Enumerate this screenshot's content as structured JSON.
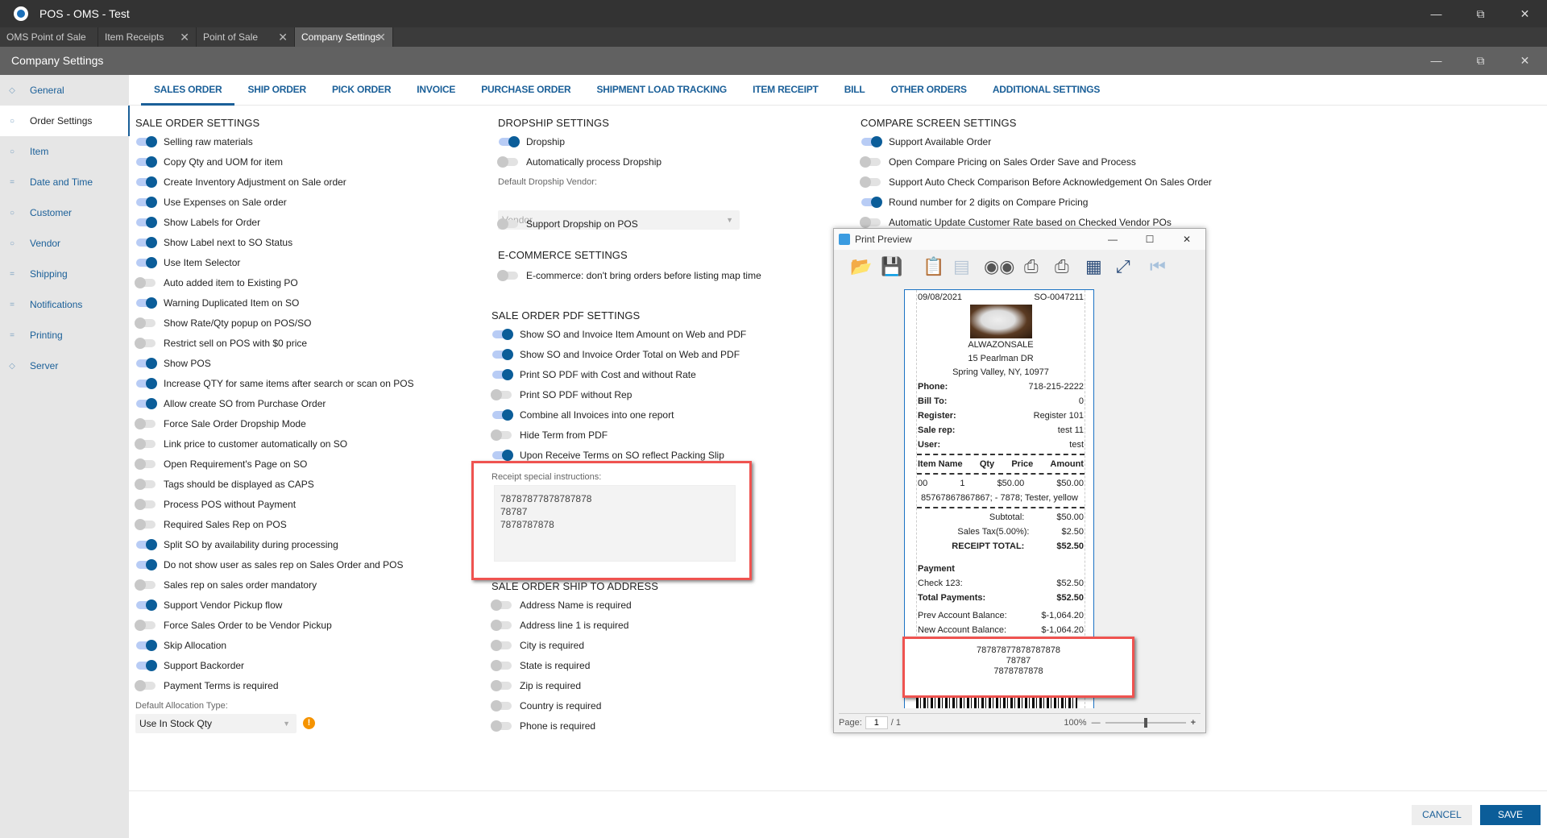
{
  "app_title": "POS - OMS - Test",
  "doc_tabs": [
    {
      "label": "OMS Point of Sale",
      "closable": false
    },
    {
      "label": "Item Receipts",
      "closable": true
    },
    {
      "label": "Point of Sale",
      "closable": true
    },
    {
      "label": "Company Settings",
      "closable": true,
      "active": true
    }
  ],
  "header_title": "Company Settings",
  "sidebar": [
    {
      "label": "General",
      "icon": "◇"
    },
    {
      "label": "Order Settings",
      "icon": "○",
      "active": true
    },
    {
      "label": "Item",
      "icon": "○"
    },
    {
      "label": "Date and Time",
      "icon": "="
    },
    {
      "label": "Customer",
      "icon": "○"
    },
    {
      "label": "Vendor",
      "icon": "○"
    },
    {
      "label": "Shipping",
      "icon": "="
    },
    {
      "label": "Notifications",
      "icon": "="
    },
    {
      "label": "Printing",
      "icon": "="
    },
    {
      "label": "Server",
      "icon": "◇"
    }
  ],
  "tabs": [
    "SALES ORDER",
    "SHIP ORDER",
    "PICK ORDER",
    "INVOICE",
    "PURCHASE ORDER",
    "SHIPMENT LOAD TRACKING",
    "ITEM RECEIPT",
    "BILL",
    "OTHER ORDERS",
    "ADDITIONAL SETTINGS"
  ],
  "sale_order_settings": {
    "title": "SALE ORDER SETTINGS",
    "items": [
      {
        "label": "Selling raw materials",
        "on": true
      },
      {
        "label": "Copy Qty and UOM for item",
        "on": true
      },
      {
        "label": "Create Inventory Adjustment on Sale order",
        "on": true
      },
      {
        "label": "Use Expenses on Sale order",
        "on": true
      },
      {
        "label": "Show Labels for Order",
        "on": true
      },
      {
        "label": "Show Label next to SO Status",
        "on": true
      },
      {
        "label": "Use Item Selector",
        "on": true
      },
      {
        "label": "Auto added item to Existing PO",
        "on": false
      },
      {
        "label": "Warning Duplicated Item on SO",
        "on": true
      },
      {
        "label": "Show Rate/Qty popup on POS/SO",
        "on": false
      },
      {
        "label": "Restrict sell on POS with $0 price",
        "on": false
      },
      {
        "label": "Show POS",
        "on": true
      },
      {
        "label": "Increase QTY for same items after search or scan on POS",
        "on": true
      },
      {
        "label": "Allow create SO from Purchase Order",
        "on": true
      },
      {
        "label": "Force Sale Order Dropship Mode",
        "on": false
      },
      {
        "label": "Link price to customer automatically on SO",
        "on": false
      },
      {
        "label": "Open Requirement's Page on SO",
        "on": false
      },
      {
        "label": "Tags should be displayed as CAPS",
        "on": false
      },
      {
        "label": "Process POS without Payment",
        "on": false
      },
      {
        "label": "Required Sales Rep on POS",
        "on": false
      },
      {
        "label": "Split SO by availability during processing",
        "on": true
      },
      {
        "label": "Do not show user as sales rep on Sales Order and POS",
        "on": true
      },
      {
        "label": "Sales rep on sales order mandatory",
        "on": false
      },
      {
        "label": "Support Vendor Pickup flow",
        "on": true
      },
      {
        "label": "Force Sales Order to be Vendor Pickup",
        "on": false
      },
      {
        "label": "Skip Allocation",
        "on": true
      },
      {
        "label": "Support Backorder",
        "on": true
      },
      {
        "label": "Payment Terms is required",
        "on": false
      }
    ],
    "allocation_label": "Default Allocation Type:",
    "allocation_value": "Use In Stock Qty"
  },
  "dropship": {
    "title": "DROPSHIP SETTINGS",
    "items": [
      {
        "label": "Dropship",
        "on": true
      },
      {
        "label": "Automatically process Dropship",
        "on": false
      }
    ],
    "vendor_label": "Default Dropship Vendor:",
    "vendor_placeholder": "Vendor",
    "pos_item": {
      "label": "Support Dropship on POS",
      "on": false
    }
  },
  "ecommerce": {
    "title": "E-COMMERCE SETTINGS",
    "items": [
      {
        "label": "E-commerce: don't bring orders before listing map time",
        "on": false
      }
    ]
  },
  "pdf": {
    "title": "SALE ORDER PDF SETTINGS",
    "items": [
      {
        "label": "Show SO and Invoice Item Amount on Web and PDF",
        "on": true
      },
      {
        "label": "Show SO and Invoice Order Total on Web and PDF",
        "on": true
      },
      {
        "label": "Print SO PDF with Cost and without Rate",
        "on": true
      },
      {
        "label": "Print SO PDF without Rep",
        "on": false
      },
      {
        "label": "Combine all Invoices into one report",
        "on": true
      },
      {
        "label": "Hide Term from PDF",
        "on": false
      },
      {
        "label": "Upon Receive Terms on SO reflect Packing Slip",
        "on": true
      }
    ],
    "instructions_label": "Receipt special instructions:",
    "instructions": "78787877878787878\n78787\n7878787878"
  },
  "ship_to": {
    "title": "SALE ORDER SHIP TO ADDRESS",
    "items": [
      {
        "label": "Address Name is required",
        "on": false
      },
      {
        "label": "Address line 1 is required",
        "on": false
      },
      {
        "label": "City is required",
        "on": false
      },
      {
        "label": "State is required",
        "on": false
      },
      {
        "label": "Zip is required",
        "on": false
      },
      {
        "label": "Country is required",
        "on": false
      },
      {
        "label": "Phone is required",
        "on": false
      }
    ]
  },
  "compare": {
    "title": "COMPARE SCREEN SETTINGS",
    "items": [
      {
        "label": "Support Available Order",
        "on": true
      },
      {
        "label": "Open Compare Pricing on Sales Order Save and Process",
        "on": false
      },
      {
        "label": "Support Auto Check Comparison Before Acknowledgement On Sales Order",
        "on": false
      },
      {
        "label": "Round number for 2 digits on Compare Pricing",
        "on": true
      },
      {
        "label": "Automatic Update Customer Rate based on Checked Vendor POs",
        "on": false
      }
    ]
  },
  "print_preview": {
    "title": "Print Preview",
    "page_label": "Page:",
    "page": "1",
    "page_total": "/ 1",
    "zoom": "100%",
    "zoom_level": 0.5,
    "receipt": {
      "date": "09/08/2021",
      "number": "SO-0047211",
      "company": "ALWAZONSALE",
      "address1": "15 Pearlman DR",
      "address2": "Spring Valley, NY, 10977",
      "info": [
        [
          "Phone:",
          "718-215-2222"
        ],
        [
          "Bill To:",
          "0"
        ],
        [
          "Register:",
          "Register 101"
        ],
        [
          "Sale rep:",
          "test 11"
        ],
        [
          "User:",
          "test"
        ]
      ],
      "columns": [
        "Item Name",
        "Qty",
        "Price",
        "Amount"
      ],
      "line": [
        "00",
        "1",
        "$50.00",
        "$50.00"
      ],
      "line_desc": "85767867867867; - 7878; Tester, yellow",
      "subtotal": [
        "Subtotal:",
        "$50.00"
      ],
      "tax": [
        "Sales Tax(5.00%):",
        "$2.50"
      ],
      "total": [
        "RECEIPT TOTAL:",
        "$52.50"
      ],
      "payment_title": "Payment",
      "check": [
        "Check 123:",
        "$52.50"
      ],
      "total_payments": [
        "Total Payments:",
        "$52.50"
      ],
      "prev_balance": [
        "Prev Account Balance:",
        "$-1,064.20"
      ],
      "new_balance": [
        "New Account Balance:",
        "$-1,064.20"
      ],
      "instructions": [
        "78787877878787878",
        "78787",
        "7878787878"
      ]
    }
  },
  "footer": {
    "cancel": "CANCEL",
    "save": "SAVE"
  },
  "colors": {
    "accent": "#0b5d99",
    "highlight": "#ef5350",
    "warning": "#f59300"
  }
}
